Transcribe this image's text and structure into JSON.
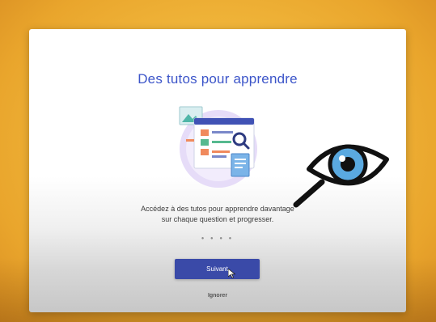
{
  "modal": {
    "title": "Des tutos pour apprendre",
    "description_line1": "Accédez à des tutos pour apprendre davantage",
    "description_line2": "sur chaque question et progresser.",
    "pagination_dots": "● ● ● ●",
    "next_button_label": "Suivant",
    "skip_link_label": "Ignorer"
  },
  "colors": {
    "accent": "#3c55c9",
    "button": "#3a4aa8",
    "background": "#f0b53a"
  },
  "icons": [
    "tutorial-illustration-icon",
    "eye-magnifier-icon",
    "cursor-icon"
  ]
}
